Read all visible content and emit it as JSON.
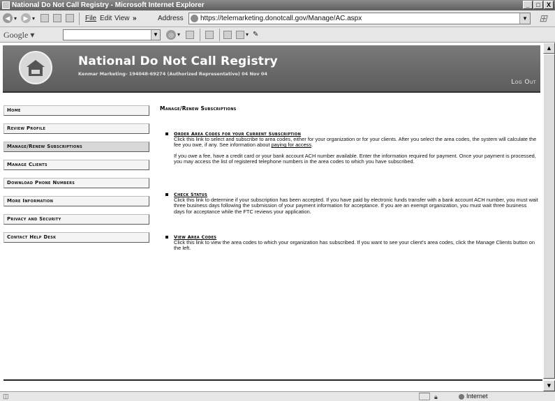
{
  "window": {
    "title": "National Do Not Call Registry - Microsoft Internet Explorer",
    "controls": [
      "_",
      "□",
      "X"
    ]
  },
  "toolbar": {
    "menu": [
      "File",
      "Edit",
      "View"
    ],
    "overflow": "»",
    "address_label": "Address",
    "address_url": "https://telemarketing.donotcall.gov/Manage/AC.aspx"
  },
  "google_bar": {
    "logo": "Google",
    "search_value": ""
  },
  "banner": {
    "title": "National Do Not Call Registry",
    "subtitle": "Kenmar Marketing- 194048-69274 (Authorized Representative) 04 Nov 04",
    "logout": "Log Out"
  },
  "nav": [
    {
      "label": "Home",
      "active": false
    },
    {
      "label": "Review Profile",
      "active": false
    },
    {
      "label": "Manage/Renew Subscriptions",
      "active": true
    },
    {
      "label": "Manage Clients",
      "active": false
    },
    {
      "label": "Download Phone Numbers",
      "active": false
    },
    {
      "label": "More Information",
      "active": false
    },
    {
      "label": "Privacy and Security",
      "active": false
    },
    {
      "label": "Contact Help Desk",
      "active": false
    }
  ],
  "main": {
    "title": "Manage/Renew Subscriptions",
    "sections": [
      {
        "link": "Order Area Codes for your Current Subscription",
        "paragraph1_text": "Click this link to select and subscribe to area codes, either for your organization or for your clients. After you select the area codes, the system will calculate the fee you owe, if any. See information about ",
        "paragraph1_link": "paying for access",
        "paragraph1_end": ".",
        "paragraph2": "If you owe a fee, have a credit card or your bank account ACH number available. Enter the information required for payment. Once your payment is processed, you may access the list of registered telephone numbers in the area codes to which you have subscribed."
      },
      {
        "link": "Check Status",
        "paragraph1": "Click this link to determine if your subscription has been accepted. If you have paid by electronic funds transfer with a bank account ACH number, you must wait three business days following the submission of your payment information for acceptance. If you are an exempt organization, you must wait three business days for acceptance while the FTC reviews your application."
      },
      {
        "link": "View Area Codes",
        "paragraph1": "Click this link to view the area codes to which your organization has subscribed. If you want to see your client's area codes, click the Manage Clients button on the left."
      }
    ]
  },
  "status": {
    "zone": "Internet"
  },
  "colors": {
    "banner": "#6b6b6b",
    "titlebar": "#7a7a7a"
  }
}
